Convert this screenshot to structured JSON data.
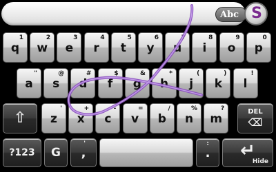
{
  "topbar": {
    "abc_label": "Abc",
    "logo_letter": "S"
  },
  "rows": {
    "r1": [
      {
        "k": "q",
        "s": "1"
      },
      {
        "k": "w",
        "s": "2"
      },
      {
        "k": "e",
        "s": "3"
      },
      {
        "k": "r",
        "s": "4"
      },
      {
        "k": "t",
        "s": "5"
      },
      {
        "k": "y",
        "s": "6"
      },
      {
        "k": "u",
        "s": "7"
      },
      {
        "k": "i",
        "s": "8"
      },
      {
        "k": "o",
        "s": "9"
      },
      {
        "k": "p",
        "s": "0"
      }
    ],
    "r2": [
      {
        "k": "a",
        "s": "\""
      },
      {
        "k": "s",
        "s": "@"
      },
      {
        "k": "d",
        "s": "#"
      },
      {
        "k": "f",
        "s": "$"
      },
      {
        "k": "g",
        "s": "&"
      },
      {
        "k": "h",
        "s": "*"
      },
      {
        "k": "j",
        "s": "("
      },
      {
        "k": "k",
        "s": ")"
      },
      {
        "k": "l",
        "s": "!"
      }
    ],
    "r3": [
      {
        "k": "z",
        "s": "'"
      },
      {
        "k": "x",
        "s": "+"
      },
      {
        "k": "c",
        "s": "-"
      },
      {
        "k": "v",
        "s": "="
      },
      {
        "k": "b",
        "s": "/"
      },
      {
        "k": "n",
        "s": "%"
      },
      {
        "k": "m",
        "s": "?"
      }
    ]
  },
  "keys": {
    "shift_label": "⇧",
    "del_label": "DEL",
    "numbers_label": "?123",
    "g_label": "G",
    "comma_label": ",",
    "comma_sub": "'",
    "period_label": ".",
    "period_sub": ":",
    "hide_label": "Hide",
    "enter_icon": "↵"
  },
  "colors": {
    "accent": "#6d2a7a",
    "swipe": "#8b4fc0"
  }
}
